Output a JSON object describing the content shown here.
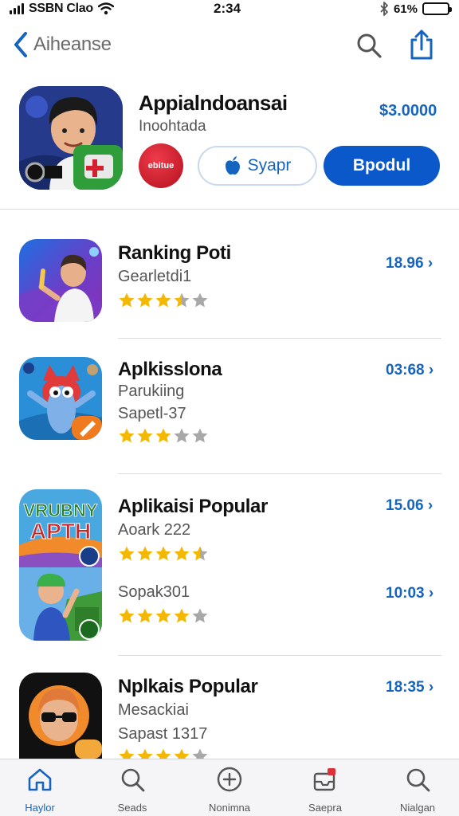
{
  "status_bar": {
    "carrier": "SSBN Clao",
    "time": "2:34",
    "battery": "61%",
    "battery_level": 0.61
  },
  "nav": {
    "back_label": "Aiheanse",
    "icons": [
      "chevron-left-icon",
      "search-icon",
      "share-icon"
    ]
  },
  "featured": {
    "title": "Appialndoansai",
    "subtitle": "Inoohtada",
    "price": "$3.0000",
    "badge_text": "ebitue",
    "secondary_button": "Syapr",
    "primary_button": "Bpodul"
  },
  "apps": [
    {
      "title": "Ranking Poti",
      "lines": [
        "Gearletdi1"
      ],
      "price": "18.96",
      "rating": 3.5
    },
    {
      "title": "Aplkisslona",
      "lines": [
        "Parukiing",
        "Sapetl-37"
      ],
      "price": "03:68",
      "rating": 3
    },
    {
      "title": "Aplikaisi Popular",
      "lines": [
        "Aoark 222"
      ],
      "price": "15.06",
      "rating": 4.5
    },
    {
      "title": "",
      "lines": [
        "Sopak301"
      ],
      "price": "10:03",
      "rating": 4
    },
    {
      "title": "Nplkais Popular",
      "lines": [
        "Mesackiai",
        "Sapast 1317"
      ],
      "price": "18:35",
      "rating": 4
    }
  ],
  "icon_texts": {
    "app3_line1": "VRUBNY",
    "app3_line2": "APTH"
  },
  "tabs": [
    {
      "label": "Haylor",
      "icon": "home-icon",
      "active": true
    },
    {
      "label": "Seads",
      "icon": "search-icon",
      "active": false
    },
    {
      "label": "Nonimna",
      "icon": "plus-circle-icon",
      "active": false
    },
    {
      "label": "Saepra",
      "icon": "inbox-icon",
      "active": false
    },
    {
      "label": "Nialgan",
      "icon": "search-icon",
      "active": false
    }
  ],
  "colors": {
    "accent": "#1565c0",
    "primary_button": "#0a58c9",
    "star_filled": "#f5b800",
    "star_empty": "#a8a8a8"
  }
}
